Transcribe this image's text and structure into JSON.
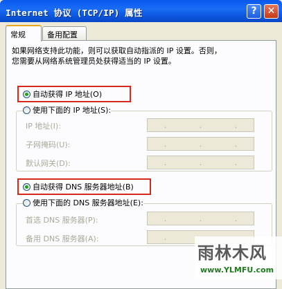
{
  "window": {
    "title": "Internet 协议 (TCP/IP) 属性",
    "help_label": "?",
    "close_label": "✕"
  },
  "tabs": [
    {
      "label": "常规",
      "active": true
    },
    {
      "label": "备用配置",
      "active": false
    }
  ],
  "description": "如果网络支持此功能，则可以获取自动指派的 IP 设置。否则，\n您需要从网络系统管理员处获得适当的 IP 设置。",
  "ip_section": {
    "auto_label": "自动获得 IP 地址(O)",
    "manual_label": "使用下面的 IP 地址(S):",
    "auto_selected": true,
    "fields": [
      {
        "label": "IP 地址(I):"
      },
      {
        "label": "子网掩码(U):"
      },
      {
        "label": "默认网关(D):"
      }
    ]
  },
  "dns_section": {
    "auto_label": "自动获得 DNS 服务器地址(B)",
    "manual_label": "使用下面的 DNS 服务器地址(E):",
    "auto_selected": true,
    "fields": [
      {
        "label": "首选 DNS 服务器(P):"
      },
      {
        "label": "备用 DNS 服务器(A):"
      }
    ]
  },
  "watermark": {
    "text": "雨林木风",
    "url": "www.YLMFU.com"
  },
  "colors": {
    "highlight_border": "#d9261c",
    "radio_checked": "#21a121",
    "titlebar": "#0b5df2"
  }
}
